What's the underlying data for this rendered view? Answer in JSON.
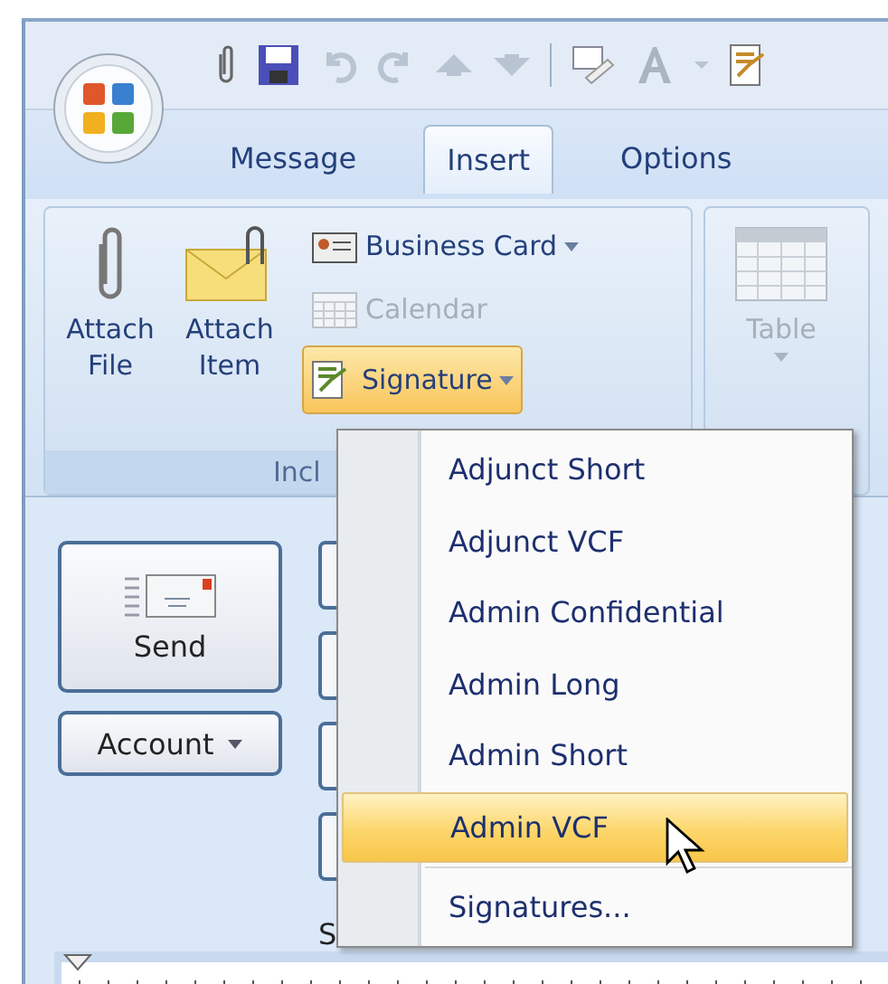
{
  "tabs": [
    {
      "label": "Message",
      "selected": false
    },
    {
      "label": "Insert",
      "selected": true
    },
    {
      "label": "Options",
      "selected": false
    }
  ],
  "ribbon": {
    "include_group": {
      "label": "Incl",
      "large_buttons": [
        {
          "kind": "paperclip",
          "label": "Attach File"
        },
        {
          "kind": "envelope",
          "label": "Attach Item"
        }
      ],
      "small_buttons": [
        {
          "kind": "card",
          "label": "Business Card",
          "dropdown": true,
          "disabled": false,
          "highlighted": false
        },
        {
          "kind": "calendar",
          "label": "Calendar",
          "dropdown": false,
          "disabled": true,
          "highlighted": false
        },
        {
          "kind": "signature",
          "label": "Signature",
          "dropdown": true,
          "disabled": false,
          "highlighted": true
        }
      ]
    },
    "table_group": {
      "label": "Table",
      "disabled": true
    }
  },
  "compose": {
    "send_button": "Send",
    "account_button": "Account",
    "field_label": "S"
  },
  "signature_menu": {
    "items": [
      {
        "label": "Adjunct Short",
        "selected": false
      },
      {
        "label": "Adjunct VCF",
        "selected": false
      },
      {
        "label": "Admin Confidential",
        "selected": false
      },
      {
        "label": "Admin Long",
        "selected": false
      },
      {
        "label": "Admin Short",
        "selected": false
      },
      {
        "label": "Admin VCF",
        "selected": true
      }
    ],
    "footer": "Signatures..."
  }
}
